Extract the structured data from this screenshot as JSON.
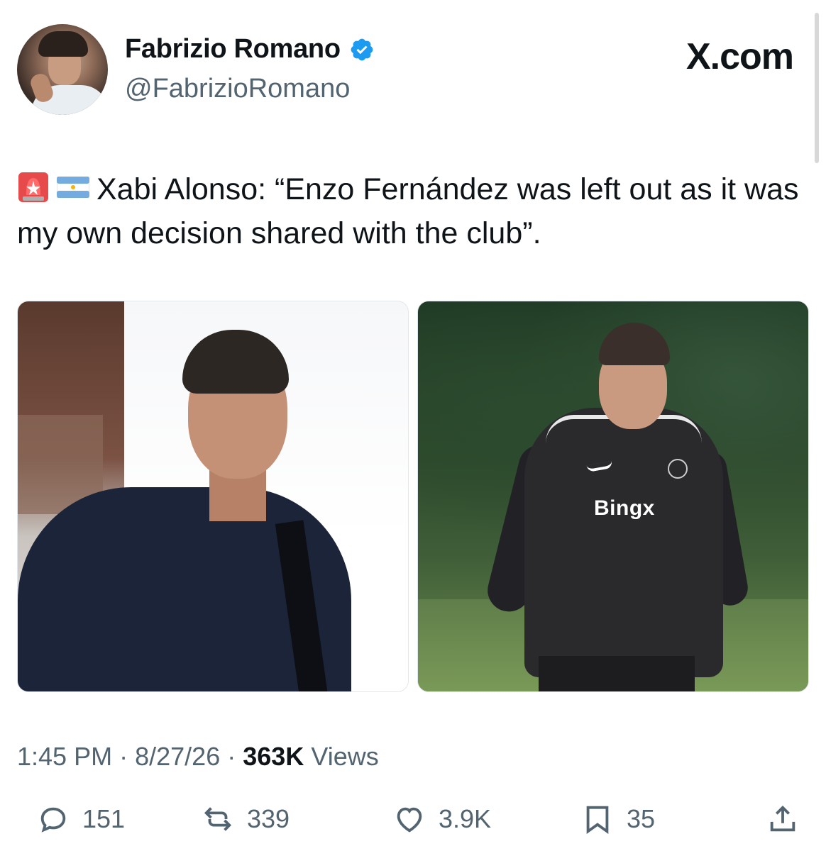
{
  "header": {
    "display_name": "Fabrizio Romano",
    "handle": "@FabrizioRomano",
    "verified": true,
    "brand": "X.com"
  },
  "tweet": {
    "emojis": [
      "rotating-light-icon",
      "argentina-flag-icon"
    ],
    "text": "Xabi Alonso: “Enzo Fernández was left out as it was my own decision shared with the club”."
  },
  "media": {
    "left_photo": "Xabi Alonso portrait",
    "right_photo": {
      "sponsor_text": "Bingx"
    }
  },
  "meta": {
    "time": "1:45 PM",
    "separator": "·",
    "date": "8/27/26",
    "views_count": "363K",
    "views_label": "Views"
  },
  "actions": {
    "replies": "151",
    "reposts": "339",
    "likes": "3.9K",
    "bookmarks": "35"
  },
  "colors": {
    "text": "#0f1419",
    "secondary": "#536471",
    "verified_blue": "#1d9bf0"
  }
}
